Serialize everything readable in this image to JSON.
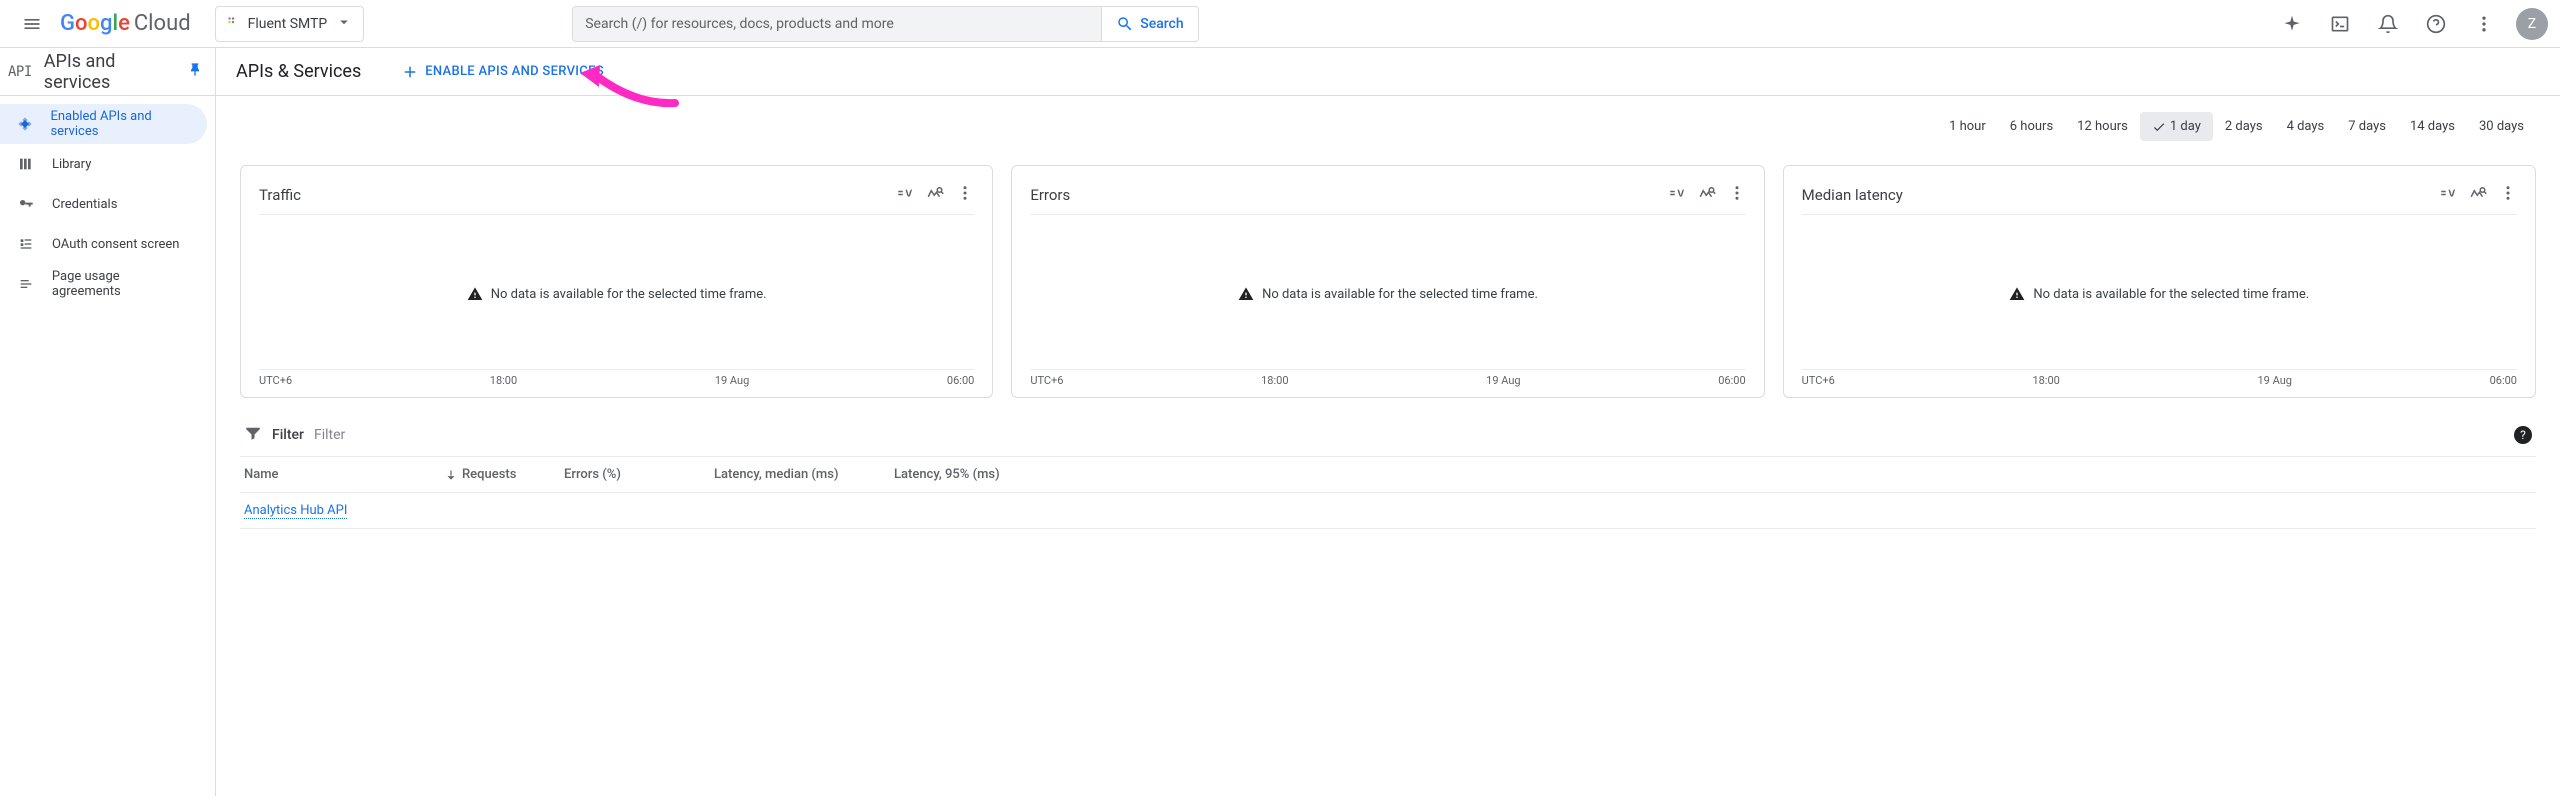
{
  "topbar": {
    "logo_cloud": "Cloud",
    "project_name": "Fluent SMTP",
    "search_placeholder": "Search (/) for resources, docs, products and more",
    "search_button": "Search",
    "avatar_initial": "Z"
  },
  "subheader": {
    "product_code": "API",
    "product_title": "APIs and services",
    "page_heading": "APIs & Services",
    "enable_button": "Enable APIs and services"
  },
  "sidebar": {
    "items": [
      {
        "label": "Enabled APIs and services",
        "icon": "diamond"
      },
      {
        "label": "Library",
        "icon": "library"
      },
      {
        "label": "Credentials",
        "icon": "key"
      },
      {
        "label": "OAuth consent screen",
        "icon": "consent"
      },
      {
        "label": "Page usage agreements",
        "icon": "agreement"
      }
    ]
  },
  "time_range": {
    "options": [
      "1 hour",
      "6 hours",
      "12 hours",
      "1 day",
      "2 days",
      "4 days",
      "7 days",
      "14 days",
      "30 days"
    ],
    "selected": "1 day"
  },
  "cards": [
    {
      "title": "Traffic",
      "message": "No data is available for the selected time frame.",
      "axis": [
        "UTC+6",
        "18:00",
        "19 Aug",
        "06:00"
      ]
    },
    {
      "title": "Errors",
      "message": "No data is available for the selected time frame.",
      "axis": [
        "UTC+6",
        "18:00",
        "19 Aug",
        "06:00"
      ]
    },
    {
      "title": "Median latency",
      "message": "No data is available for the selected time frame.",
      "axis": [
        "UTC+6",
        "18:00",
        "19 Aug",
        "06:00"
      ]
    }
  ],
  "filter": {
    "label": "Filter",
    "placeholder": "Filter"
  },
  "table": {
    "columns": [
      "Name",
      "Requests",
      "Errors (%)",
      "Latency, median (ms)",
      "Latency, 95% (ms)"
    ],
    "rows": [
      {
        "name": "Analytics Hub API"
      }
    ]
  }
}
